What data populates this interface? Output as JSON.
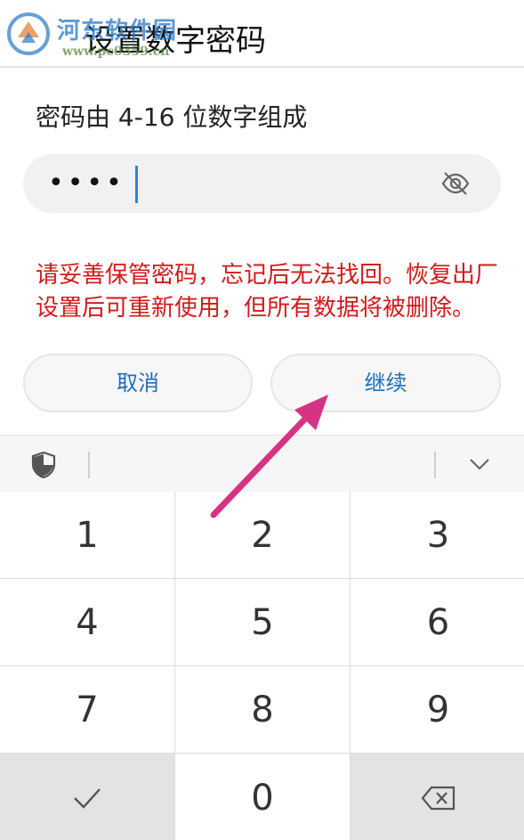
{
  "watermark": {
    "logo_icon": "site-logo-icon",
    "title": "河东软件园",
    "url": "www.pc0359.cn"
  },
  "header": {
    "title": "设置数字密码"
  },
  "hint": "密码由 4-16 位数字组成",
  "password_field": {
    "masked_value": "••••",
    "visibility_icon": "eye-off-icon"
  },
  "warning": "请妥善保管密码，忘记后无法找回。恢复出厂设置后可重新使用，但所有数据将被删除。",
  "buttons": {
    "cancel": "取消",
    "continue": "继续"
  },
  "keyboard": {
    "toolbar": {
      "security_icon": "shield-icon",
      "collapse_icon": "chevron-down-icon"
    },
    "keys": [
      "1",
      "2",
      "3",
      "4",
      "5",
      "6",
      "7",
      "8",
      "9",
      "0"
    ],
    "done_icon": "checkmark-icon",
    "delete_icon": "backspace-icon"
  },
  "colors": {
    "warning": "#d11a1a",
    "button_text": "#1f6fb8",
    "caret": "#2a86d4",
    "annotation_arrow": "#d63384"
  }
}
